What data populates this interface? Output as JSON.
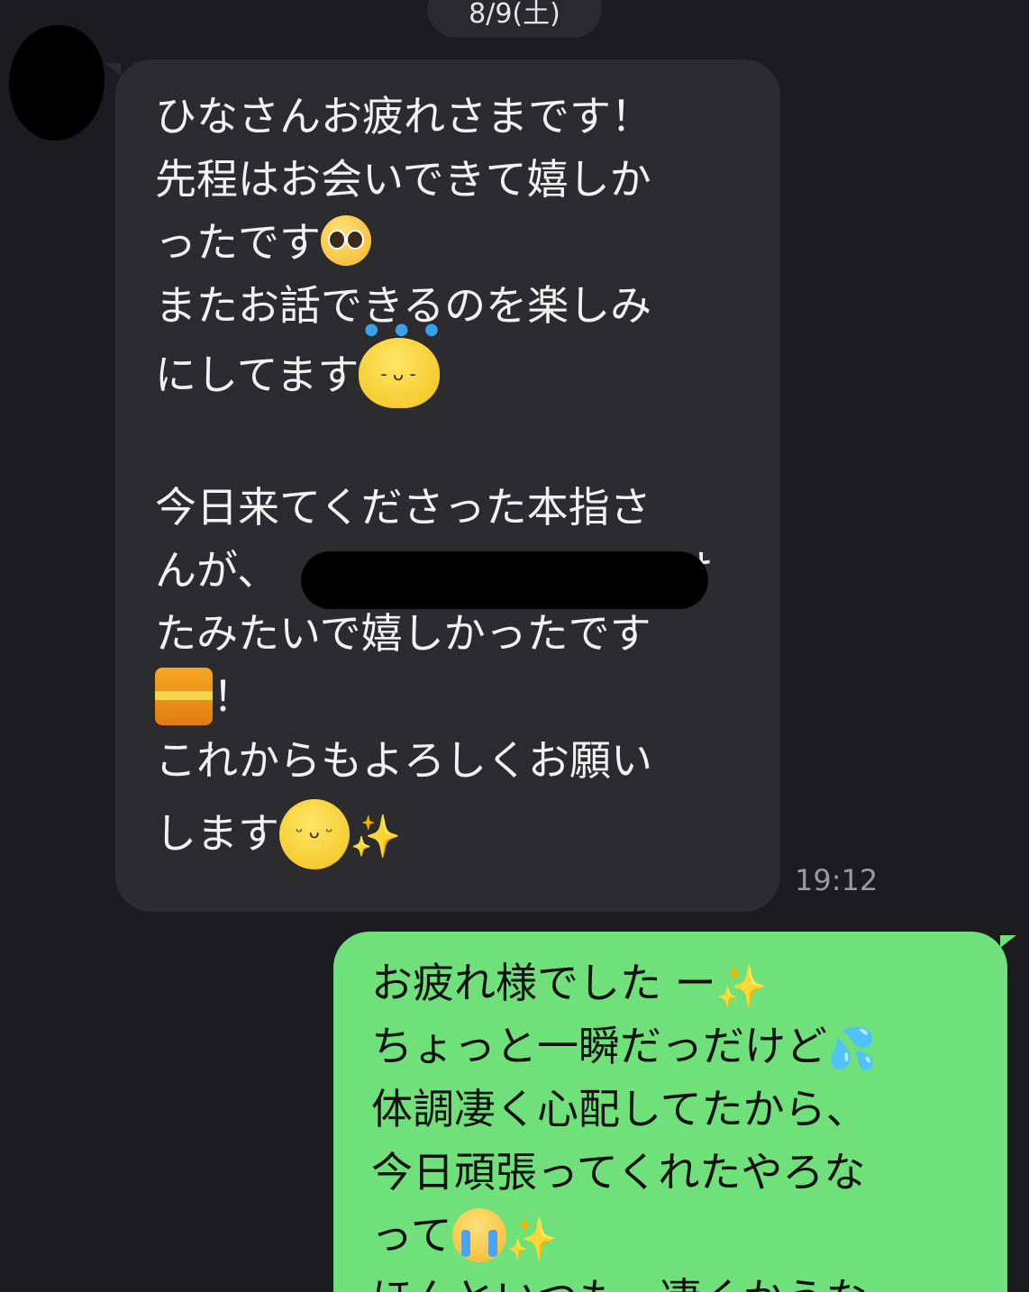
{
  "header": {
    "date": "8/9(土)"
  },
  "incoming": {
    "lines": [
      "ひなさんお疲れさまです！",
      "先程はお会いできて嬉しか",
      "ったです",
      "またお話できるのを楽しみ",
      "にしてます",
      "今日来てくださった本指さ",
      "んが、",
      "け",
      "たみたいで嬉しかったです",
      "！",
      "これからもよろしくお願い",
      "します"
    ],
    "time": "19:12"
  },
  "outgoing": {
    "lines": [
      "お疲れ様でした ー",
      "ちょっと一瞬だっだけど",
      "体調凄く心配してたから、",
      "今日頑張ってくれたやろな",
      "って",
      "ほんといつも、凄くかうな"
    ]
  },
  "emoji": {
    "pleading": "pleading-face",
    "sweat_blob": "sweating-blob",
    "kimono": "kimono",
    "smile_blob": "smiling-blob",
    "sparkles": "✨",
    "droplets": "💦",
    "crying": "loudly-crying-face"
  },
  "colors": {
    "background": "#1c1c1e",
    "incoming_bubble": "#2c2c2e",
    "outgoing_bubble": "#6fe07a"
  }
}
